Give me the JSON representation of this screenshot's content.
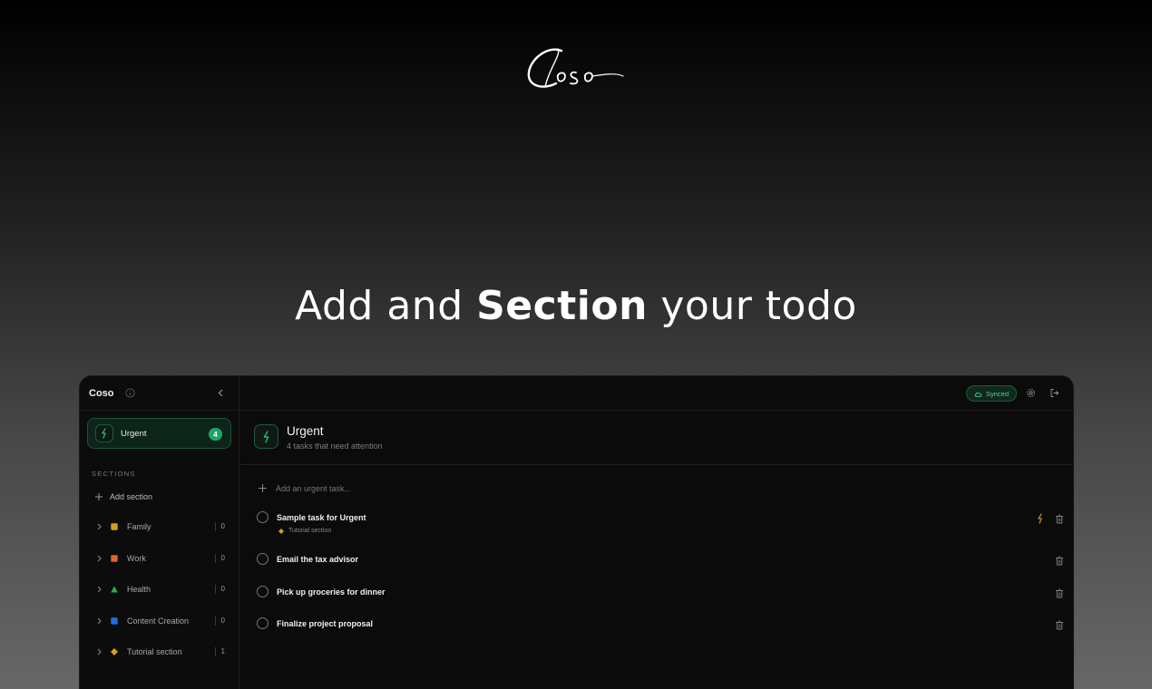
{
  "brand": {
    "logo_text": "Coso"
  },
  "hero": {
    "pre": "Add and ",
    "bold": "Section",
    "post": " your todo"
  },
  "app": {
    "sidebar": {
      "title": "Coso",
      "urgent": {
        "label": "Urgent",
        "count": "4"
      },
      "sections_label": "SECTIONS",
      "add_section_label": "Add section",
      "sections": [
        {
          "name": "Family",
          "count": "0",
          "color": "#d4a017",
          "shape": "square"
        },
        {
          "name": "Work",
          "count": "0",
          "color": "#e0652a",
          "shape": "square"
        },
        {
          "name": "Health",
          "count": "0",
          "color": "#2fa84f",
          "shape": "triangle"
        },
        {
          "name": "Content Creation",
          "count": "0",
          "color": "#1f6fe0",
          "shape": "square"
        },
        {
          "name": "Tutorial section",
          "count": "1",
          "color": "#d4a017",
          "shape": "diamond"
        }
      ]
    },
    "topbar": {
      "synced_label": "Synced"
    },
    "page": {
      "title": "Urgent",
      "subtitle": "4 tasks that need attention",
      "add_placeholder": "Add an urgent task..."
    },
    "tasks": [
      {
        "title": "Sample task for Urgent",
        "section": "Tutorial section",
        "urgent": true
      },
      {
        "title": "Email the tax advisor"
      },
      {
        "title": "Pick up groceries for dinner"
      },
      {
        "title": "Finalize project proposal"
      }
    ],
    "colors": {
      "accent": "#1fa36a",
      "urgent_icon": "#2ecf8a",
      "urgent_flag": "#e0a030"
    }
  }
}
